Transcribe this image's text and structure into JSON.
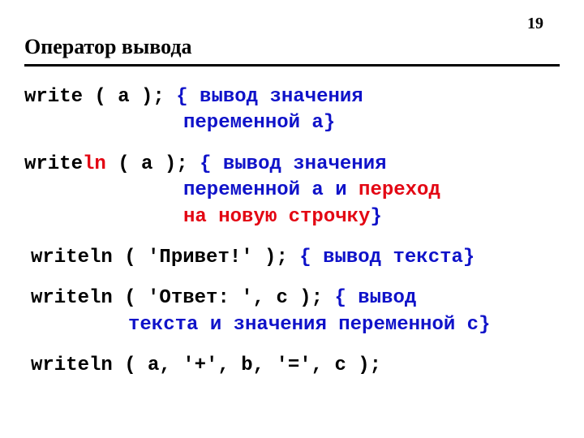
{
  "pageNumber": "19",
  "title": "Оператор вывода",
  "line1": {
    "code": "write ( a );",
    "pad": "   ",
    "c1": "{ вывод значения",
    "c2": "переменной a}"
  },
  "line2": {
    "code1": "write",
    "code2": "ln",
    "code3": " ( a );",
    "pad": " ",
    "c1": "{ вывод значения",
    "c2a": "переменной a и ",
    "c2b_red": "переход",
    "c3_red": "на новую строчку",
    "c3_brace": "}"
  },
  "line3": {
    "code": "writeln ( 'Привет!' ); ",
    "c": "{ вывод текста}"
  },
  "line4": {
    "code": "writeln ( 'Ответ: ', c );",
    "pad": "   ",
    "c1": "{ вывод",
    "c2": "текста и значения переменной c}"
  },
  "line5": {
    "code": "writeln ( a, '+', b, '=', c );"
  }
}
